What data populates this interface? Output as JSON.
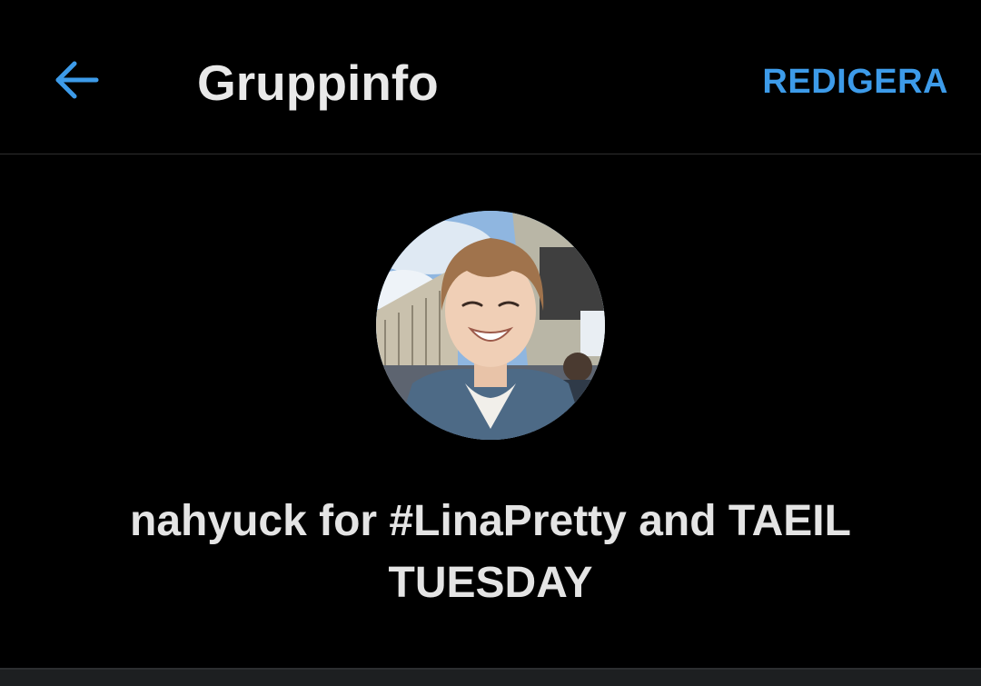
{
  "header": {
    "back_icon": "arrow-left-icon",
    "title": "Gruppinfo",
    "edit_label": "REDIGERA"
  },
  "group": {
    "avatar_icon": "group-avatar-photo",
    "name": "nahyuck for #LinaPretty and TAEIL TUESDAY"
  },
  "colors": {
    "background": "#000000",
    "accent": "#3d9be9",
    "text_primary": "#e9e9e9",
    "divider": "#2e2e2e"
  }
}
